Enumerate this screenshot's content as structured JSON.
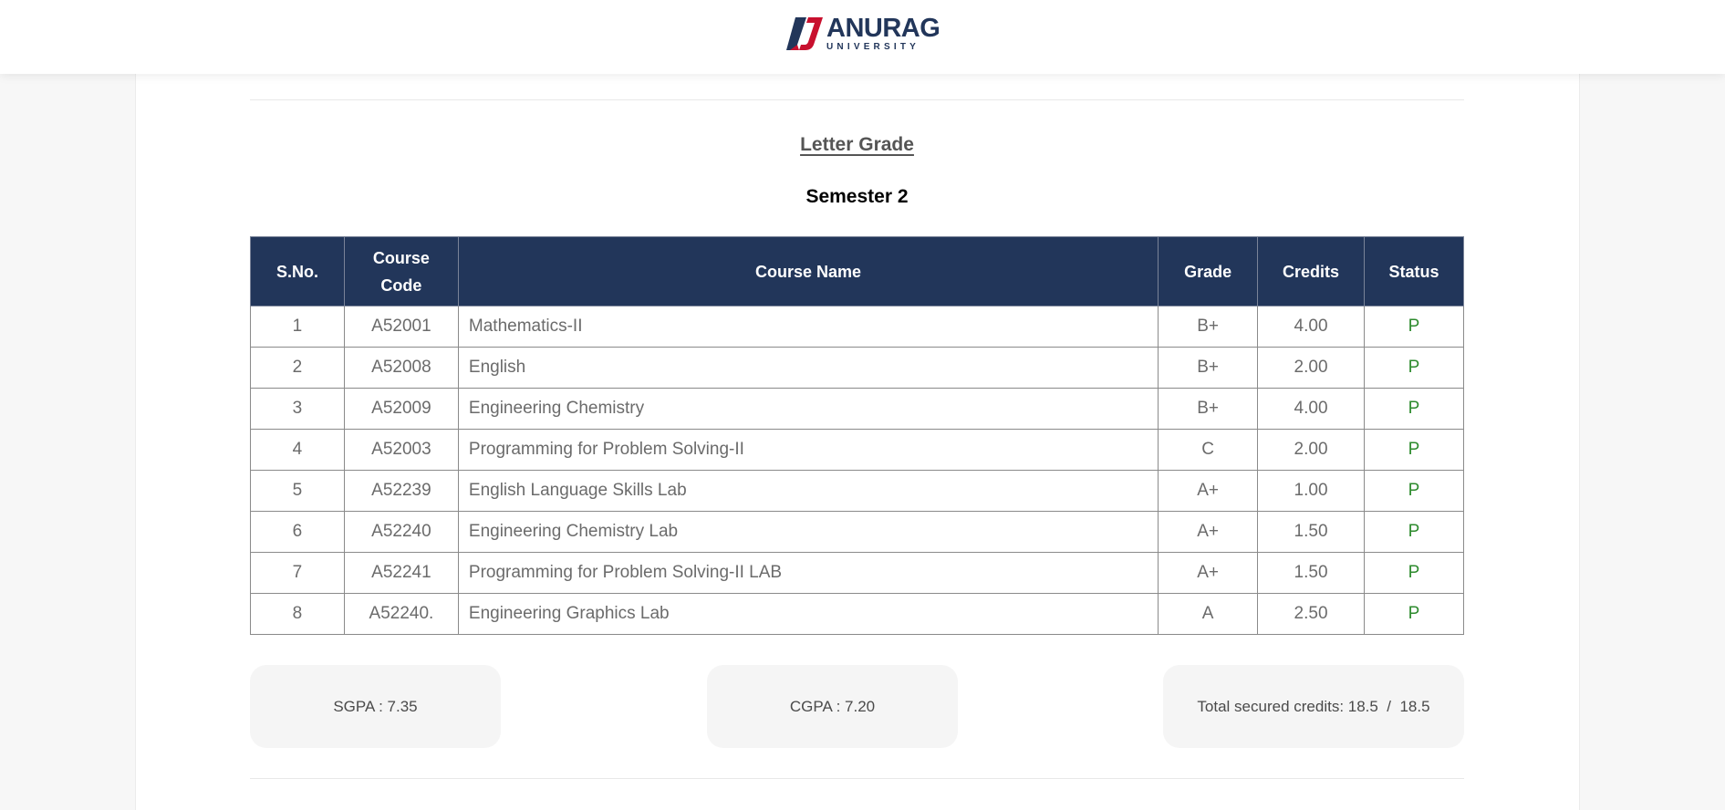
{
  "header": {
    "logo_name": "ANURAG",
    "logo_sub": "UNIVERSITY"
  },
  "main": {
    "title": "Letter Grade",
    "semester": "Semester 2"
  },
  "table": {
    "columns": [
      "S.No.",
      "Course Code",
      "Course Name",
      "Grade",
      "Credits",
      "Status"
    ],
    "rows": [
      {
        "sno": "1",
        "code": "A52001",
        "name": "Mathematics-II",
        "grade": "B+",
        "credits": "4.00",
        "status": "P"
      },
      {
        "sno": "2",
        "code": "A52008",
        "name": "English",
        "grade": "B+",
        "credits": "2.00",
        "status": "P"
      },
      {
        "sno": "3",
        "code": "A52009",
        "name": "Engineering Chemistry",
        "grade": "B+",
        "credits": "4.00",
        "status": "P"
      },
      {
        "sno": "4",
        "code": "A52003",
        "name": "Programming for Problem Solving-II",
        "grade": "C",
        "credits": "2.00",
        "status": "P"
      },
      {
        "sno": "5",
        "code": "A52239",
        "name": "English Language Skills Lab",
        "grade": "A+",
        "credits": "1.00",
        "status": "P"
      },
      {
        "sno": "6",
        "code": "A52240",
        "name": "Engineering Chemistry Lab",
        "grade": "A+",
        "credits": "1.50",
        "status": "P"
      },
      {
        "sno": "7",
        "code": "A52241",
        "name": "Programming for Problem Solving-II LAB",
        "grade": "A+",
        "credits": "1.50",
        "status": "P"
      },
      {
        "sno": "8",
        "code": "A52240.",
        "name": "Engineering Graphics Lab",
        "grade": "A",
        "credits": "2.50",
        "status": "P"
      }
    ]
  },
  "summary": {
    "sgpa": "SGPA : 7.35",
    "cgpa": "CGPA : 7.20",
    "total_credits": "Total secured credits: 18.5  /  18.5"
  },
  "colors": {
    "header_bg": "#22365a",
    "status_pass": "#2e8b2e",
    "logo_red": "#c8102e"
  }
}
